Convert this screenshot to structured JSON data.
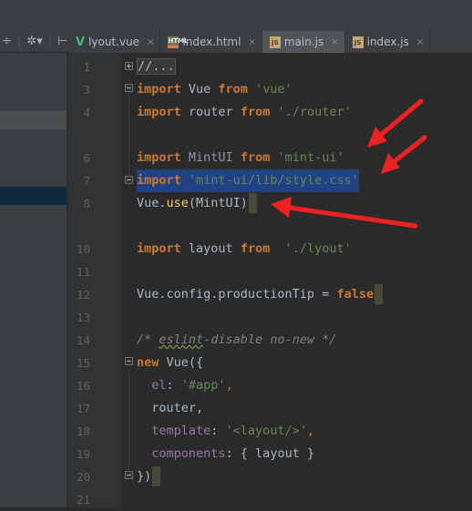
{
  "toolbar": {
    "divide_icon": "÷",
    "separator": "|",
    "settings_icon": "✲▾",
    "collapse_icon": "⊢"
  },
  "tabs": [
    {
      "label": "lyout.vue",
      "icon": "vue-icon",
      "active": false
    },
    {
      "label": "index.html",
      "icon": "html-file-icon",
      "active": false
    },
    {
      "label": "main.js",
      "icon": "js-file-icon",
      "active": true
    },
    {
      "label": "index.js",
      "icon": "js-file-icon",
      "active": false
    }
  ],
  "close_glyph": "×",
  "file_icon_text": {
    "html": "HTML",
    "js": "JS",
    "vue": "V"
  },
  "lines": [
    {
      "number": "1"
    },
    {
      "number": "3"
    },
    {
      "number": "4"
    },
    {
      "number": "6"
    },
    {
      "number": "7"
    },
    {
      "number": "8"
    },
    {
      "number": "10"
    },
    {
      "number": "11"
    },
    {
      "number": "12"
    },
    {
      "number": "13"
    },
    {
      "number": "14"
    },
    {
      "number": "15"
    },
    {
      "number": "16"
    },
    {
      "number": "17"
    },
    {
      "number": "18"
    },
    {
      "number": "19"
    },
    {
      "number": "20"
    },
    {
      "number": "21"
    }
  ],
  "code": {
    "l1": "//...",
    "l3_kw": "import",
    "l3_id": " Vue ",
    "l3_from": "from",
    "l3_str": " 'vue'",
    "l4_kw": "import",
    "l4_id": " router ",
    "l4_from": "from",
    "l4_str": " './router'",
    "l6_kw": "import",
    "l6_id": " MintUI ",
    "l6_from": "from",
    "l6_str": " 'mint-ui'",
    "l7_kw": "import",
    "l7_str": " 'mint-ui/lib/style.css'",
    "l8_obj": "Vue.",
    "l8_fn": "use",
    "l8_args": "(MintUI)",
    "l10_kw": "import",
    "l10_id": " layout ",
    "l10_from": "from",
    "l10_str": "  './lyout'",
    "l12_obj": "Vue.config.productionTip = ",
    "l12_val": "false",
    "l14": "/* eslint-disable no-new */",
    "l14_pre": "/* ",
    "l14_eslint": "eslint",
    "l14_post": "-disable no-new */",
    "l15_kw": "new",
    "l15_rest": " Vue({",
    "l16_key": "  el",
    "l16_colon": ": ",
    "l16_str": "'#app'",
    "l16_comma": ",",
    "l17": "  router,",
    "l18_key": "  template",
    "l18_colon": ": ",
    "l18_str": "'<layout/>'",
    "l18_comma": ",",
    "l19_key": "  components",
    "l19_rest": ": { layout }",
    "l20": "})"
  }
}
